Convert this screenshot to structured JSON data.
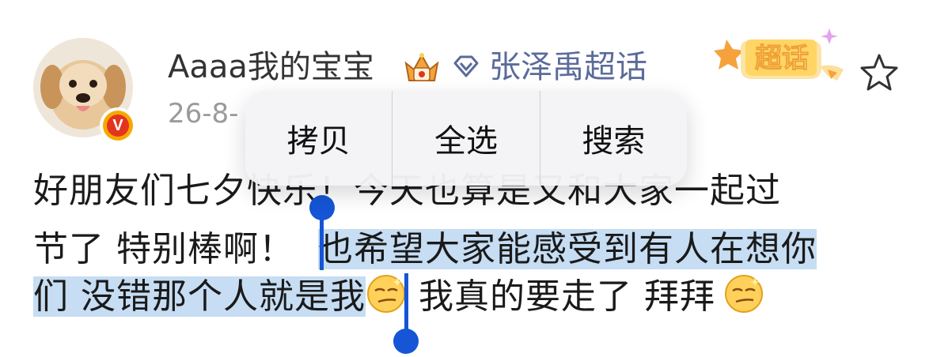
{
  "post": {
    "username": "Aaaa我的宝宝",
    "topic": "张泽禹超话",
    "date": "26-8-",
    "text_line1": "好朋友们七夕快乐！今天也算是又和大家一起过",
    "text_line2_plain": "节了 特别棒啊！",
    "text_line2_selected": "也希望大家能感受到有人在想你",
    "text_line3_selected": "们 没错那个人就是我",
    "text_line3_after": " 我真的要走了 拜拜",
    "verified_badge": "V"
  },
  "supertopic_badge": {
    "label": "超话"
  },
  "context_menu": {
    "items": [
      "拷贝",
      "全选",
      "搜索"
    ]
  },
  "colors": {
    "selection": "#c6ddf3",
    "handle": "#1555d6",
    "topic": "#5b6b9a",
    "badge": "#f7a800"
  },
  "icons": [
    "crown-badge-icon",
    "diamond-icon",
    "star-icon",
    "smirk-emoji-icon",
    "verified-v-icon",
    "supertopic-badge-icon"
  ]
}
